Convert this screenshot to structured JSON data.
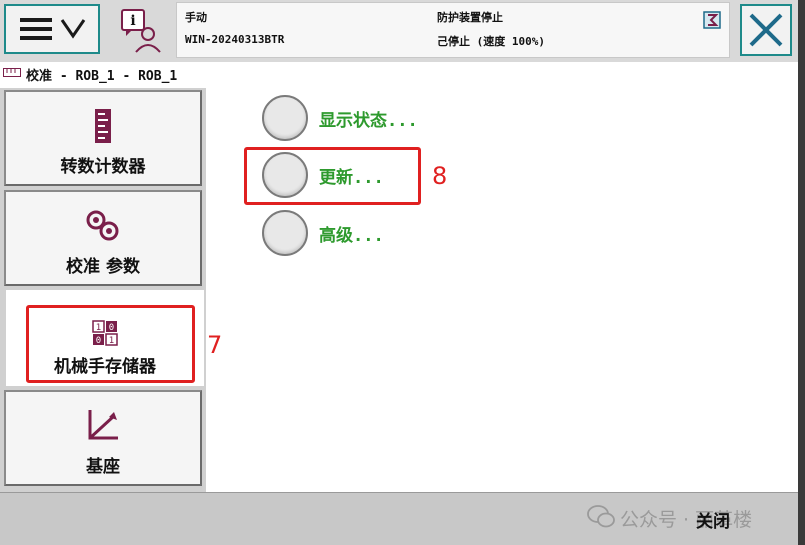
{
  "topbar": {
    "mode": "手动",
    "controller": "WIN-20240313BTR",
    "safety_state": "防护装置停止",
    "run_state": "己停止 (速度 100%)"
  },
  "breadcrumb": "校准 - ROB_1 - ROB_1",
  "sidebar": {
    "items": [
      {
        "label": "转数计数器"
      },
      {
        "label": "校准 参数"
      },
      {
        "label": "机械手存储器"
      },
      {
        "label": "基座"
      }
    ]
  },
  "options": [
    {
      "label": "显示状态..."
    },
    {
      "label": "更新..."
    },
    {
      "label": "高级..."
    }
  ],
  "annotations": {
    "sidebar_marker": "7",
    "option_marker": "8"
  },
  "bottombar": {
    "close_label": "关闭",
    "watermark": "公众号 · 丽革楼"
  },
  "colors": {
    "accent": "#1e8a8a",
    "option_text": "#2e9a2e",
    "annotation": "#e02020",
    "icon": "#7a1f4a"
  }
}
